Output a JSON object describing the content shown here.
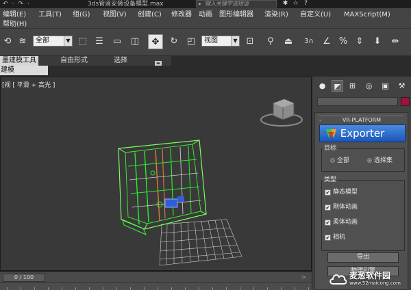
{
  "titlebar": {
    "quick_access": [
      "↶",
      "·",
      "↷",
      "·"
    ],
    "document_title": "3ds管道安装设备模型.max",
    "search_placeholder": "键入关键字或短语",
    "buttons": [
      "✱",
      "☆",
      "?"
    ]
  },
  "menubar": {
    "items": [
      "编辑(E)",
      "工具(T)",
      "组(G)",
      "视图(V)",
      "创建(C)",
      "修改器",
      "动画",
      "图形编辑器",
      "渲染(R)",
      "自定义(U)",
      "MAXScript(M)"
    ],
    "help": "帮助(H)"
  },
  "toolbar": {
    "selection_filter": "全部",
    "reference_coord": "视图",
    "snap_label": "3"
  },
  "ribbon": {
    "tabs": [
      "墨建模工具",
      "自由形式",
      "选择"
    ],
    "active_tab": 0,
    "subtab": "建模"
  },
  "viewport": {
    "label": "[视 [ 平滑 + 高光 ]"
  },
  "timeline": {
    "frame": "0 / 100",
    "arrow": ">"
  },
  "command_panel": {
    "tabs": [
      "create-sphere-icon",
      "modify-bend-icon",
      "hierarchy-icon",
      "motion-icon",
      "display-icon",
      "utilities-hammer-icon"
    ],
    "color_swatch": "#a2123a",
    "rollout_title": "VR-PLATFORM",
    "rollout_sign": "-",
    "exporter_label": "Exporter",
    "target_group": {
      "label": "目标",
      "options": [
        "全部",
        "选择集"
      ],
      "selected": 1
    },
    "type_group": {
      "label": "类型",
      "items": [
        "静态模型",
        "刚体动画",
        "柔体动画",
        "相机"
      ],
      "checked": [
        true,
        true,
        true,
        true
      ]
    },
    "export_button": "导出",
    "next_button": "物理引擎"
  },
  "watermark": {
    "name": "麦葱软件园",
    "url": "www.52maicong.com"
  }
}
